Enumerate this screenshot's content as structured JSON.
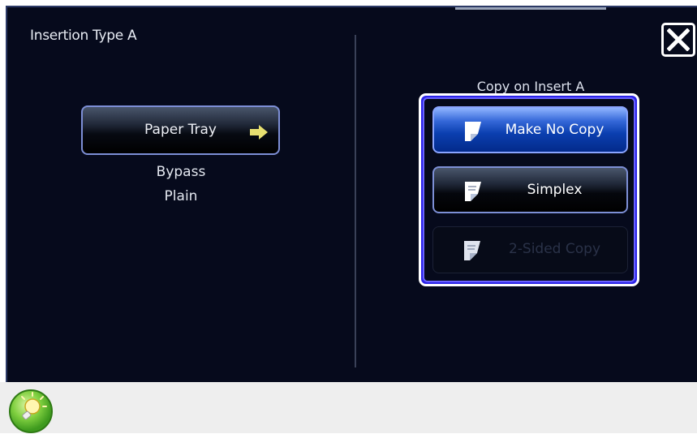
{
  "dialog": {
    "title": "Insertion Type A"
  },
  "paper_source": {
    "button_label": "Paper Tray",
    "tray": "Bypass",
    "paper_type": "Plain"
  },
  "copy_options": {
    "group_label": "Copy on Insert A",
    "items": [
      {
        "label": "Make No Copy",
        "selected": true,
        "enabled": true
      },
      {
        "label": "Simplex",
        "selected": false,
        "enabled": true
      },
      {
        "label": "2-Sided Copy",
        "selected": false,
        "enabled": false
      }
    ]
  },
  "icons": {
    "close": "close-icon",
    "arrow": "arrow-right-icon",
    "document": "document-icon",
    "status": "lightbulb-icon"
  },
  "colors": {
    "panel_bg": "#060a1c",
    "accent_selected": "#0b3fb0",
    "group_border": "#2a22e8",
    "arrow": "#e8e070",
    "status_icon": "#6cc43a"
  }
}
